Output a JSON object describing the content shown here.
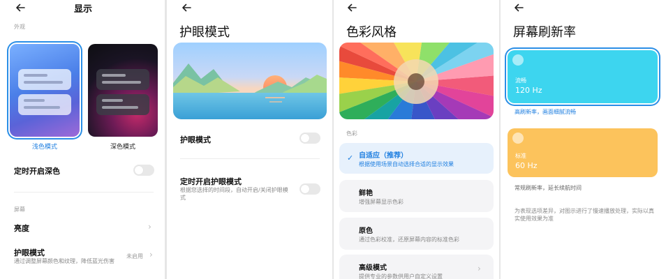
{
  "colors": {
    "accent": "#1f7fe0",
    "rate_120": "#3dd5ef",
    "rate_60": "#fcc35c"
  },
  "icons": {
    "back": "arrow-left-icon",
    "chevron": "chevron-right-icon",
    "check": "checkmark-icon"
  },
  "display": {
    "title": "显示",
    "appearance_section": "外观",
    "light_label": "浅色模式",
    "dark_label": "深色模式",
    "scheduled_dark": "定时开启深色",
    "screen_section": "屏幕",
    "brightness": "亮度",
    "eye_care": "护眼模式",
    "eye_care_sub": "通过调整屏幕颜色和纹理，降低蓝光伤害",
    "eye_care_value": "未启用",
    "scheduled_dark_on": false
  },
  "eye_mode": {
    "title": "护眼模式",
    "toggle_label": "护眼模式",
    "schedule_label": "定时开启护眼模式",
    "schedule_sub": "根据您选择的时间段，自动开启/关闭护眼模式",
    "toggle_on": false,
    "schedule_on": false
  },
  "color_style": {
    "title": "色彩风格",
    "section": "色彩",
    "options": [
      {
        "title": "自适应（推荐）",
        "sub": "根据使用场景自动选择合适的显示效果",
        "selected": true
      },
      {
        "title": "鲜艳",
        "sub": "增强屏幕显示色彩",
        "selected": false
      },
      {
        "title": "原色",
        "sub": "通过色彩校准，还原屏幕内容的标准色彩",
        "selected": false
      },
      {
        "title": "高级模式",
        "sub": "提供专业的参数供用户自定义设置",
        "selected": false
      }
    ]
  },
  "refresh": {
    "title": "屏幕刷新率",
    "options": [
      {
        "name": "流畅",
        "value": "120 Hz",
        "desc": "高刷新率，画面细腻流畅",
        "selected": true
      },
      {
        "name": "标准",
        "value": "60 Hz",
        "desc": "常规刷新率，延长续航时间",
        "selected": false
      }
    ],
    "footnote": "为表现选项差异，对图示进行了慢速播放处理，实际以真实使用效果为准"
  }
}
